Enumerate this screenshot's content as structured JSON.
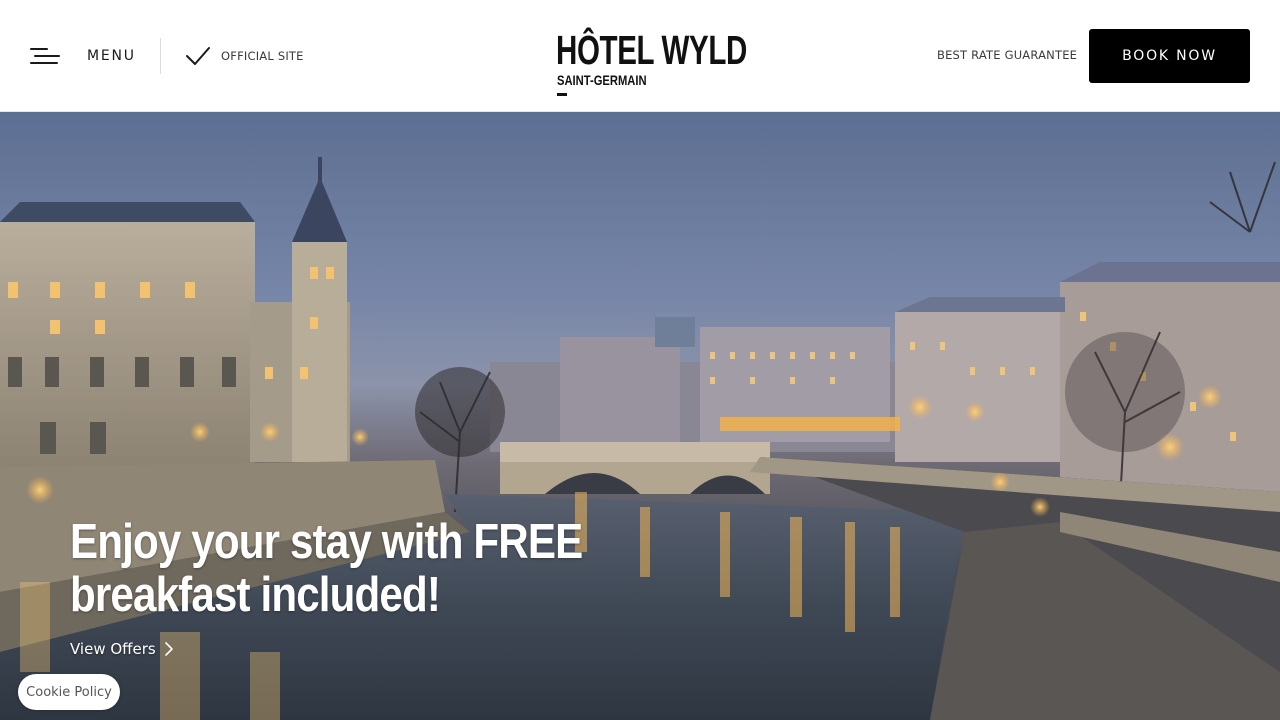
{
  "header": {
    "menu_label": "MENU",
    "official_site_label": "OFFICIAL SITE",
    "logo_main": "HÔTEL WYLD",
    "logo_sub": "SAINT-GERMAIN",
    "best_rate_label": "BEST RATE GUARANTEE",
    "book_now_label": "BOOK NOW"
  },
  "hero": {
    "headline_line1": "Enjoy your stay with FREE",
    "headline_line2": "breakfast included!",
    "view_offers_label": "View Offers",
    "image_subject": "paris-seine-riverbank-at-dusk"
  },
  "cookie": {
    "label": "Cookie Policy"
  },
  "colors": {
    "header_bg": "#ffffff",
    "button_bg": "#000000",
    "button_text": "#ffffff",
    "text_dark": "#1a1a1a"
  },
  "icons": [
    "hamburger-menu-icon",
    "checkmark-icon",
    "chevron-right-icon"
  ]
}
